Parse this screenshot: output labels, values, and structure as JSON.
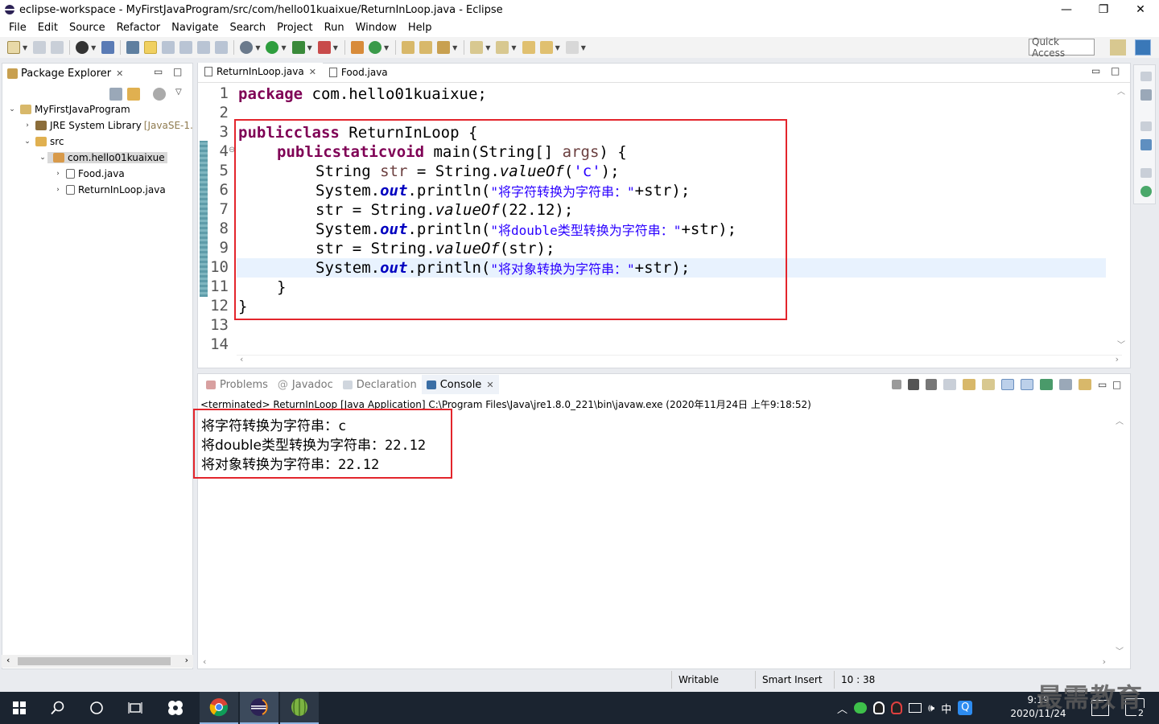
{
  "window": {
    "title": "eclipse-workspace - MyFirstJavaProgram/src/com/hello01kuaixue/ReturnInLoop.java - Eclipse",
    "minimize": "—",
    "maximize": "❐",
    "close": "✕"
  },
  "menu": [
    "File",
    "Edit",
    "Source",
    "Refactor",
    "Navigate",
    "Search",
    "Project",
    "Run",
    "Window",
    "Help"
  ],
  "toolbar": {
    "quick_access_placeholder": "Quick Access"
  },
  "package_explorer": {
    "title": "Package Explorer",
    "tree": [
      {
        "label": "MyFirstJavaProgram",
        "extra": ""
      },
      {
        "label": "JRE System Library",
        "extra": "[JavaSE-1."
      },
      {
        "label": "src",
        "extra": ""
      },
      {
        "label": "com.hello01kuaixue",
        "extra": ""
      },
      {
        "label": "Food.java",
        "extra": ""
      },
      {
        "label": "ReturnInLoop.java",
        "extra": ""
      }
    ]
  },
  "editor": {
    "tabs": [
      {
        "label": "ReturnInLoop.java",
        "active": true
      },
      {
        "label": "Food.java",
        "active": false
      }
    ],
    "line_numbers": [
      "1",
      "2",
      "3",
      "4",
      "5",
      "6",
      "7",
      "8",
      "9",
      "10",
      "11",
      "12",
      "13",
      "14"
    ],
    "code": {
      "l1_kw": "package",
      "l1_rest": " com.hello01kuaixue;",
      "l3_kw1": "public",
      "l3_kw2": "class",
      "l3_rest": " ReturnInLoop {",
      "l4_kw1": "public",
      "l4_kw2": "static",
      "l4_kw3": "void",
      "l4_rest": " main(String[] ",
      "l4_arg": "args",
      "l4_end": ") {",
      "l5_a": "String ",
      "l5_var": "str",
      "l5_b": " = String.",
      "l5_m": "valueOf",
      "l5_c": "(",
      "l5_s": "'c'",
      "l5_d": ");",
      "l6_a": "System.",
      "l6_f": "out",
      "l6_b": ".println(",
      "l6_s": "\"将字符转换为字符串：\"",
      "l6_c": "+str);",
      "l7_a": "str = String.",
      "l7_m": "valueOf",
      "l7_b": "(22.12);",
      "l8_a": "System.",
      "l8_f": "out",
      "l8_b": ".println(",
      "l8_s": "\"将double类型转换为字符串：\"",
      "l8_c": "+str);",
      "l9_a": "str = String.",
      "l9_m": "valueOf",
      "l9_b": "(str);",
      "l10_a": "System.",
      "l10_f": "out",
      "l10_b": ".println(",
      "l10_s": "\"将对象转换为字符串：\"",
      "l10_c": "+str);",
      "l11": "}",
      "l12": "}"
    }
  },
  "console": {
    "tabs": [
      "Problems",
      "Javadoc",
      "Declaration",
      "Console"
    ],
    "status": "<terminated> ReturnInLoop [Java Application] C:\\Program Files\\Java\\jre1.8.0_221\\bin\\javaw.exe (2020年11月24日 上午9:18:52)",
    "output": [
      {
        "label": "将字符转换为字符串：",
        "value": "c"
      },
      {
        "label": "将double类型转换为字符串：",
        "value": "22.12"
      },
      {
        "label": "将对象转换为字符串：",
        "value": "22.12"
      }
    ]
  },
  "statusbar": {
    "mode": "Writable",
    "insert": "Smart Insert",
    "position": "10 : 38"
  },
  "taskbar": {
    "time": "9:19",
    "date": "2020/11/24",
    "ime": "中",
    "notifications": "2",
    "watermark": "最需教育"
  },
  "colors": {
    "keyword": "#7f0055",
    "string": "#2a00ff",
    "field": "#0000c0",
    "highlight_box": "#e3252c",
    "taskbar": "#1b2430"
  }
}
